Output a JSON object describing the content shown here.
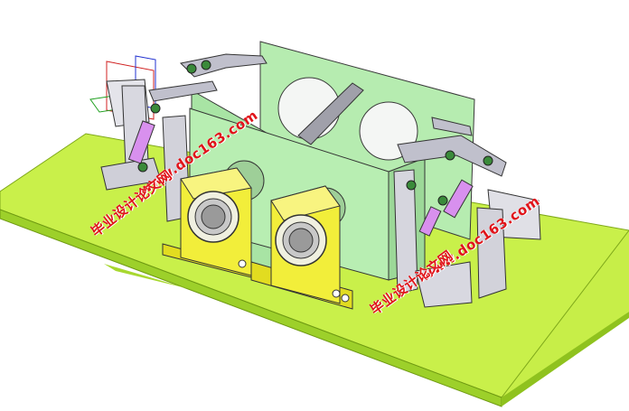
{
  "watermarks": {
    "left_url": "www.doc163.com",
    "left_cn": "毕业设计论文网",
    "right_url": "www.doc163.com",
    "right_cn": "毕业设计论文网"
  },
  "colors": {
    "base_plate_top": "#c9f04a",
    "base_plate_edge": "#8fc21e",
    "body_plate": "#b6ecb0",
    "bearing_block": "#f2ee3a",
    "arms": "#c0c0cc",
    "cylinders": "#d890ee",
    "watermark": "#e0141a"
  },
  "icons": [
    "coordinate-axis-triad-icon"
  ]
}
